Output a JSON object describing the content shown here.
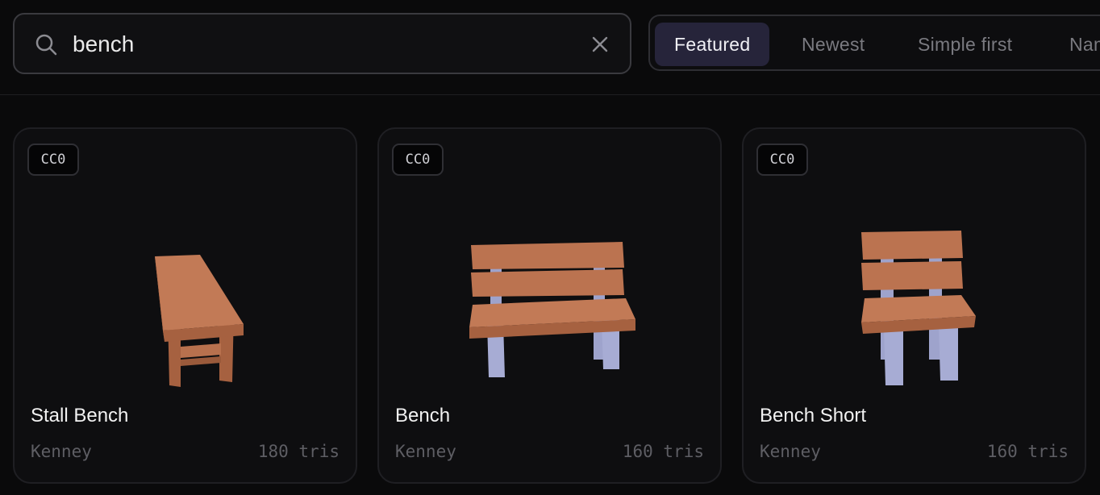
{
  "search": {
    "value": "bench",
    "placeholder": ""
  },
  "sort_tabs": [
    {
      "label": "Featured",
      "active": true
    },
    {
      "label": "Newest",
      "active": false
    },
    {
      "label": "Simple first",
      "active": false
    },
    {
      "label": "Nam",
      "active": false
    }
  ],
  "cards": [
    {
      "badge": "CC0",
      "title": "Stall Bench",
      "author": "Kenney",
      "tris": "180 tris"
    },
    {
      "badge": "CC0",
      "title": "Bench",
      "author": "Kenney",
      "tris": "160 tris"
    },
    {
      "badge": "CC0",
      "title": "Bench Short",
      "author": "Kenney",
      "tris": "160 tris"
    }
  ],
  "colors": {
    "wood": "#b8714e",
    "wood_dark": "#9a5a3b",
    "metal": "#a7acd4",
    "accent_tab": "#26243a"
  }
}
